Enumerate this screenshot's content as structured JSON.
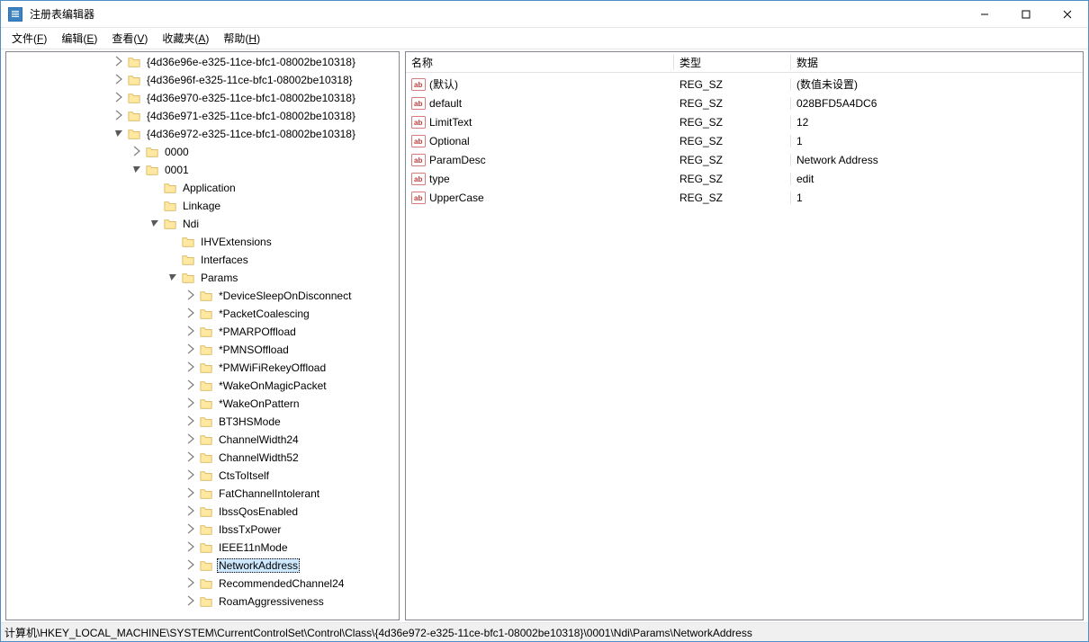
{
  "window": {
    "title": "注册表编辑器"
  },
  "menu": {
    "file": "文件(<u>F</u>)",
    "edit": "编辑(<u>E</u>)",
    "view": "查看(<u>V</u>)",
    "favorites": "收藏夹(<u>A</u>)",
    "help": "帮助(<u>H</u>)"
  },
  "tree": {
    "top_siblings": [
      "{4d36e96e-e325-11ce-bfc1-08002be10318}",
      "{4d36e96f-e325-11ce-bfc1-08002be10318}",
      "{4d36e970-e325-11ce-bfc1-08002be10318}",
      "{4d36e971-e325-11ce-bfc1-08002be10318}"
    ],
    "expanded": "{4d36e972-e325-11ce-bfc1-08002be10318}",
    "child0": "0000",
    "child1": "0001",
    "node_app": "Application",
    "node_linkage": "Linkage",
    "node_ndi": "Ndi",
    "ndi_ihv": "IHVExtensions",
    "ndi_interfaces": "Interfaces",
    "ndi_params": "Params",
    "params": [
      "*DeviceSleepOnDisconnect",
      "*PacketCoalescing",
      "*PMARPOffload",
      "*PMNSOffload",
      "*PMWiFiRekeyOffload",
      "*WakeOnMagicPacket",
      "*WakeOnPattern",
      "BT3HSMode",
      "ChannelWidth24",
      "ChannelWidth52",
      "CtsToItself",
      "FatChannelIntolerant",
      "IbssQosEnabled",
      "IbssTxPower",
      "IEEE11nMode",
      "NetworkAddress",
      "RecommendedChannel24",
      "RoamAggressiveness"
    ],
    "selected": "NetworkAddress"
  },
  "list": {
    "headers": {
      "name": "名称",
      "type": "类型",
      "data": "数据"
    },
    "rows": [
      {
        "name": "(默认)",
        "type": "REG_SZ",
        "data": "(数值未设置)"
      },
      {
        "name": "default",
        "type": "REG_SZ",
        "data": "028BFD5A4DC6"
      },
      {
        "name": "LimitText",
        "type": "REG_SZ",
        "data": "12"
      },
      {
        "name": "Optional",
        "type": "REG_SZ",
        "data": "1"
      },
      {
        "name": "ParamDesc",
        "type": "REG_SZ",
        "data": "Network Address"
      },
      {
        "name": "type",
        "type": "REG_SZ",
        "data": "edit"
      },
      {
        "name": "UpperCase",
        "type": "REG_SZ",
        "data": "1"
      }
    ]
  },
  "statusbar": {
    "path": "计算机\\HKEY_LOCAL_MACHINE\\SYSTEM\\CurrentControlSet\\Control\\Class\\{4d36e972-e325-11ce-bfc1-08002be10318}\\0001\\Ndi\\Params\\NetworkAddress"
  }
}
